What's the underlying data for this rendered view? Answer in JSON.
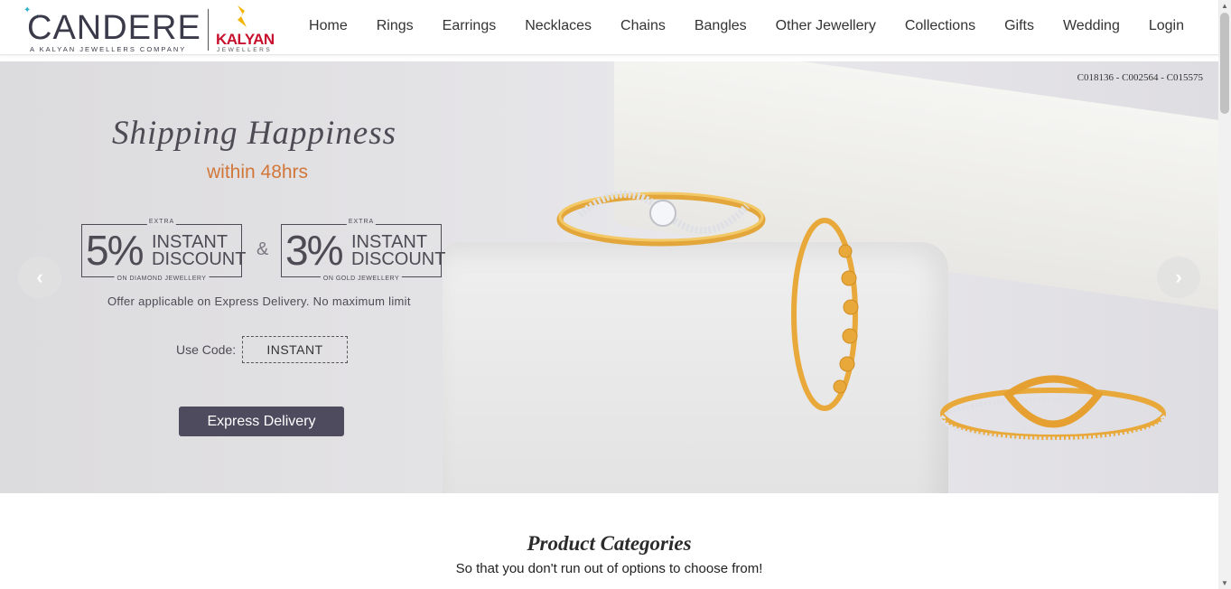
{
  "header": {
    "brand": "CANDERE",
    "brand_tagline": "A KALYAN JEWELLERS COMPANY",
    "partner": "KALYAN",
    "partner_sub": "JEWELLERS",
    "nav": [
      "Home",
      "Rings",
      "Earrings",
      "Necklaces",
      "Chains",
      "Bangles",
      "Other Jewellery",
      "Collections",
      "Gifts",
      "Wedding",
      "Login"
    ]
  },
  "hero": {
    "sku": "C018136 - C002564 - C015575",
    "title": "Shipping Happiness",
    "subtitle": "within 48hrs",
    "offer1": {
      "extra": "EXTRA",
      "pct": "5%",
      "word1": "INSTANT",
      "word2": "DISCOUNT",
      "on": "ON DIAMOND JEWELLERY"
    },
    "amp": "&",
    "offer2": {
      "extra": "EXTRA",
      "pct": "3%",
      "word1": "INSTANT",
      "word2": "DISCOUNT",
      "on": "ON GOLD JEWELLERY"
    },
    "note": "Offer applicable on Express Delivery. No maximum limit",
    "code_label": "Use Code:",
    "code": "INSTANT",
    "cta": "Express Delivery",
    "prev": "‹",
    "next": "›"
  },
  "categories": {
    "title": "Product Categories",
    "subtitle": "So that you don't run out of options to choose from!"
  },
  "colors": {
    "accent": "#2fb0c9",
    "kalyan_red": "#c8102e",
    "cta_bg": "#4e4b5f",
    "subtitle_orange": "#d2773a"
  }
}
